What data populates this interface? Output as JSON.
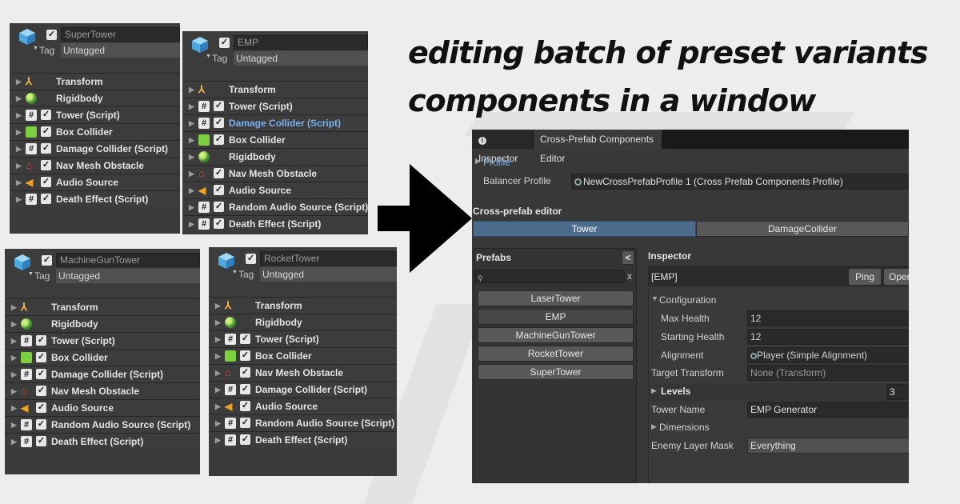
{
  "headline": {
    "line1": "editing batch of preset variants",
    "line2": "components in a window"
  },
  "colors": {
    "panel_bg": "#383838",
    "selected_tab": "#4c6b8c",
    "highlight_text": "#7ab3f0",
    "arrow": "#000000"
  },
  "panels": [
    {
      "name": "SuperTower",
      "tag_label": "Tag",
      "tag": "Untagged",
      "components": [
        {
          "label": "Transform",
          "icon": "transform-icon",
          "checkbox": false
        },
        {
          "label": "Rigidbody",
          "icon": "rigidbody-icon",
          "checkbox": false
        },
        {
          "label": "Tower (Script)",
          "icon": "script-icon",
          "checkbox": true
        },
        {
          "label": "Box Collider",
          "icon": "box-collider-icon",
          "checkbox": true
        },
        {
          "label": "Damage Collider (Script)",
          "icon": "script-icon",
          "checkbox": true
        },
        {
          "label": "Nav Mesh Obstacle",
          "icon": "nav-mesh-icon",
          "checkbox": true
        },
        {
          "label": "Audio Source",
          "icon": "audio-icon",
          "checkbox": true
        },
        {
          "label": "Death Effect (Script)",
          "icon": "script-icon",
          "checkbox": true
        }
      ]
    },
    {
      "name": "EMP",
      "tag_label": "Tag",
      "tag": "Untagged",
      "components": [
        {
          "label": "Transform",
          "icon": "transform-icon",
          "checkbox": false
        },
        {
          "label": "Tower (Script)",
          "icon": "script-icon",
          "checkbox": true
        },
        {
          "label": "Damage Collider (Script)",
          "icon": "script-icon",
          "checkbox": true,
          "highlight": true
        },
        {
          "label": "Box Collider",
          "icon": "box-collider-icon",
          "checkbox": true
        },
        {
          "label": "Rigidbody",
          "icon": "rigidbody-icon",
          "checkbox": false
        },
        {
          "label": "Nav Mesh Obstacle",
          "icon": "nav-mesh-icon",
          "checkbox": true
        },
        {
          "label": "Audio Source",
          "icon": "audio-icon",
          "checkbox": true
        },
        {
          "label": "Random Audio Source (Script)",
          "icon": "script-icon",
          "checkbox": true
        },
        {
          "label": "Death Effect (Script)",
          "icon": "script-icon",
          "checkbox": true
        }
      ]
    },
    {
      "name": "MachineGunTower",
      "tag_label": "Tag",
      "tag": "Untagged",
      "components": [
        {
          "label": "Transform",
          "icon": "transform-icon",
          "checkbox": false
        },
        {
          "label": "Rigidbody",
          "icon": "rigidbody-icon",
          "checkbox": false
        },
        {
          "label": "Tower (Script)",
          "icon": "script-icon",
          "checkbox": true
        },
        {
          "label": "Box Collider",
          "icon": "box-collider-icon",
          "checkbox": true
        },
        {
          "label": "Damage Collider (Script)",
          "icon": "script-icon",
          "checkbox": true
        },
        {
          "label": "Nav Mesh Obstacle",
          "icon": "nav-mesh-icon",
          "checkbox": true
        },
        {
          "label": "Audio Source",
          "icon": "audio-icon",
          "checkbox": true
        },
        {
          "label": "Random Audio Source (Script)",
          "icon": "script-icon",
          "checkbox": true
        },
        {
          "label": "Death Effect (Script)",
          "icon": "script-icon",
          "checkbox": true
        }
      ]
    },
    {
      "name": "RocketTower",
      "tag_label": "Tag",
      "tag": "Untagged",
      "components": [
        {
          "label": "Transform",
          "icon": "transform-icon",
          "checkbox": false
        },
        {
          "label": "Rigidbody",
          "icon": "rigidbody-icon",
          "checkbox": false
        },
        {
          "label": "Tower (Script)",
          "icon": "script-icon",
          "checkbox": true
        },
        {
          "label": "Box Collider",
          "icon": "box-collider-icon",
          "checkbox": true
        },
        {
          "label": "Nav Mesh Obstacle",
          "icon": "nav-mesh-icon",
          "checkbox": true
        },
        {
          "label": "Damage Collider (Script)",
          "icon": "script-icon",
          "checkbox": true
        },
        {
          "label": "Audio Source",
          "icon": "audio-icon",
          "checkbox": true
        },
        {
          "label": "Random Audio Source (Script)",
          "icon": "script-icon",
          "checkbox": true
        },
        {
          "label": "Death Effect (Script)",
          "icon": "script-icon",
          "checkbox": true
        }
      ]
    }
  ],
  "editor": {
    "tabs": [
      "Inspector",
      "Cross-Prefab Components Editor"
    ],
    "profile_label": "Profile",
    "balancer_label": "Balancer Profile",
    "balancer_value": "NewCrossPrefabProfile 1 (Cross Prefab Components Profile)",
    "section_title": "Cross-prefab editor",
    "component_tabs": [
      "Tower",
      "DamageCollider"
    ],
    "prefabs_title": "Prefabs",
    "collapse_button": "<",
    "search_placeholder": "",
    "clear_search": "x",
    "prefabs": [
      "LaserTower",
      "EMP",
      "MachineGunTower",
      "RocketTower",
      "SuperTower"
    ],
    "selected_prefab": "EMP",
    "inspector_title": "Inspector",
    "inspector_object": "[EMP]",
    "ping_label": "Ping",
    "open_label": "Oper",
    "configuration_label": "Configuration",
    "max_health_label": "Max Health",
    "max_health": "12",
    "starting_health_label": "Starting Health",
    "starting_health": "12",
    "alignment_label": "Alignment",
    "alignment_value": "Player (Simple Alignment)",
    "target_transform_label": "Target Transform",
    "target_transform_value": "None (Transform)",
    "levels_label": "Levels",
    "levels_value": "3",
    "tower_name_label": "Tower Name",
    "tower_name_value": "EMP Generator",
    "dimensions_label": "Dimensions",
    "enemy_layer_label": "Enemy Layer Mask",
    "enemy_layer_value": "Everything"
  }
}
